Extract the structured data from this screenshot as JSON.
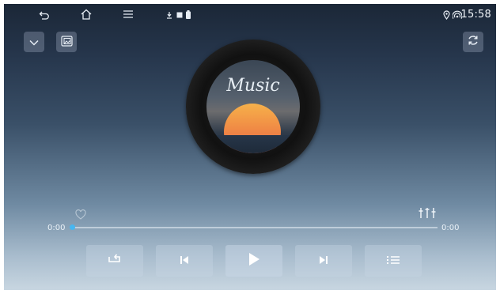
{
  "status_bar": {
    "time": "15:58",
    "nav_icons": [
      "back-icon",
      "home-icon",
      "menu-icon"
    ],
    "notification_icons": [
      "download-icon",
      "image-icon",
      "battery-icon"
    ],
    "system_icons": [
      "location-icon",
      "hotspot-icon"
    ]
  },
  "toolbar": {
    "left_buttons": [
      "chevron-down-icon",
      "gallery-icon"
    ],
    "right_button": "refresh-icon"
  },
  "album_art": {
    "label_text": "Music"
  },
  "player": {
    "current_time": "0:00",
    "total_time": "0:00",
    "progress": 0,
    "favorite_icon": "heart-outline-icon",
    "equalizer_icon": "equalizer-icon",
    "controls": [
      "repeat-icon",
      "previous-icon",
      "play-icon",
      "next-icon",
      "playlist-icon"
    ]
  },
  "colors": {
    "accent": "#47b6f0",
    "background_top": "#1b2737",
    "background_bottom": "#c8d6e1"
  }
}
